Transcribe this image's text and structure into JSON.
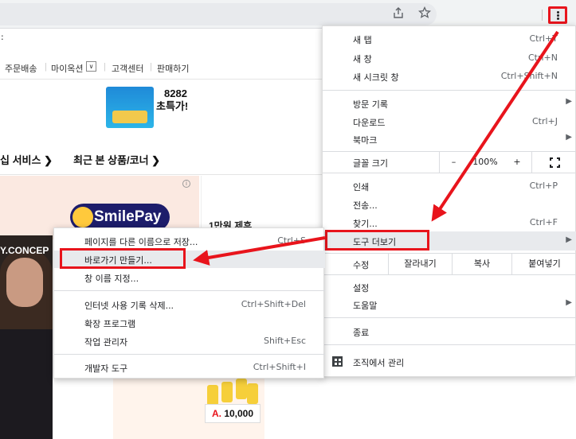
{
  "toolbar": {
    "share_icon": "share-icon",
    "star_icon": "star-icon",
    "menu_icon": "three-dots-vertical-icon"
  },
  "webpage": {
    "tab_fragment": ":",
    "top_links": [
      "주문배송",
      "마이옥션",
      "고객센터",
      "판매하기"
    ],
    "dropdown_caret": "∨",
    "promo_line1": "8282",
    "promo_line2": "초특가!",
    "nav_items": [
      "십 서비스 ❯",
      "최근 본 상품/코너 ❯"
    ],
    "ad_info": "i",
    "smilepay_label": "SmilePay",
    "side_text": "1만원 제휴",
    "banner_text": "Y.CONCEP",
    "price_prefix": "A.",
    "price": "10,000"
  },
  "chrome_menu": {
    "items_top": [
      {
        "label": "새 탭",
        "shortcut": "Ctrl+T"
      },
      {
        "label": "새 창",
        "shortcut": "Ctrl+N"
      },
      {
        "label": "새 시크릿 창",
        "shortcut": "Ctrl+Shift+N"
      }
    ],
    "items_history": [
      {
        "label": "방문 기록",
        "shortcut": "",
        "arrow": "▶"
      },
      {
        "label": "다운로드",
        "shortcut": "Ctrl+J",
        "arrow": ""
      },
      {
        "label": "북마크",
        "shortcut": "",
        "arrow": "▶"
      }
    ],
    "zoom": {
      "label": "글꼴 크기",
      "minus": "–",
      "value": "100%",
      "plus": "+"
    },
    "items_tools": [
      {
        "label": "인쇄",
        "shortcut": "Ctrl+P"
      },
      {
        "label": "전송...",
        "shortcut": ""
      },
      {
        "label": "찾기...",
        "shortcut": "Ctrl+F"
      }
    ],
    "more_tools": {
      "label": "도구 더보기",
      "arrow": "▶"
    },
    "edit": {
      "label": "수정",
      "cut": "잘라내기",
      "copy": "복사",
      "paste": "붙여넣기"
    },
    "settings": {
      "label": "설정"
    },
    "help": {
      "label": "도움말",
      "arrow": "▶"
    },
    "exit": {
      "label": "종료"
    },
    "managed": {
      "label": "조직에서 관리"
    }
  },
  "sub_menu": {
    "items": [
      {
        "label": "페이지를 다른 이름으로 저장...",
        "shortcut": "Ctrl+S"
      },
      {
        "label": "바로가기 만들기...",
        "shortcut": ""
      },
      {
        "label": "창 이름 지정...",
        "shortcut": ""
      },
      {
        "label": "인터넷 사용 기록 삭제...",
        "shortcut": "Ctrl+Shift+Del"
      },
      {
        "label": "확장 프로그램",
        "shortcut": ""
      },
      {
        "label": "작업 관리자",
        "shortcut": "Shift+Esc"
      },
      {
        "label": "개발자 도구",
        "shortcut": "Ctrl+Shift+I"
      }
    ]
  },
  "colors": {
    "highlight": "#e8141c",
    "menu_hover": "#e8eaed",
    "toolbar": "#f1f3f4"
  }
}
